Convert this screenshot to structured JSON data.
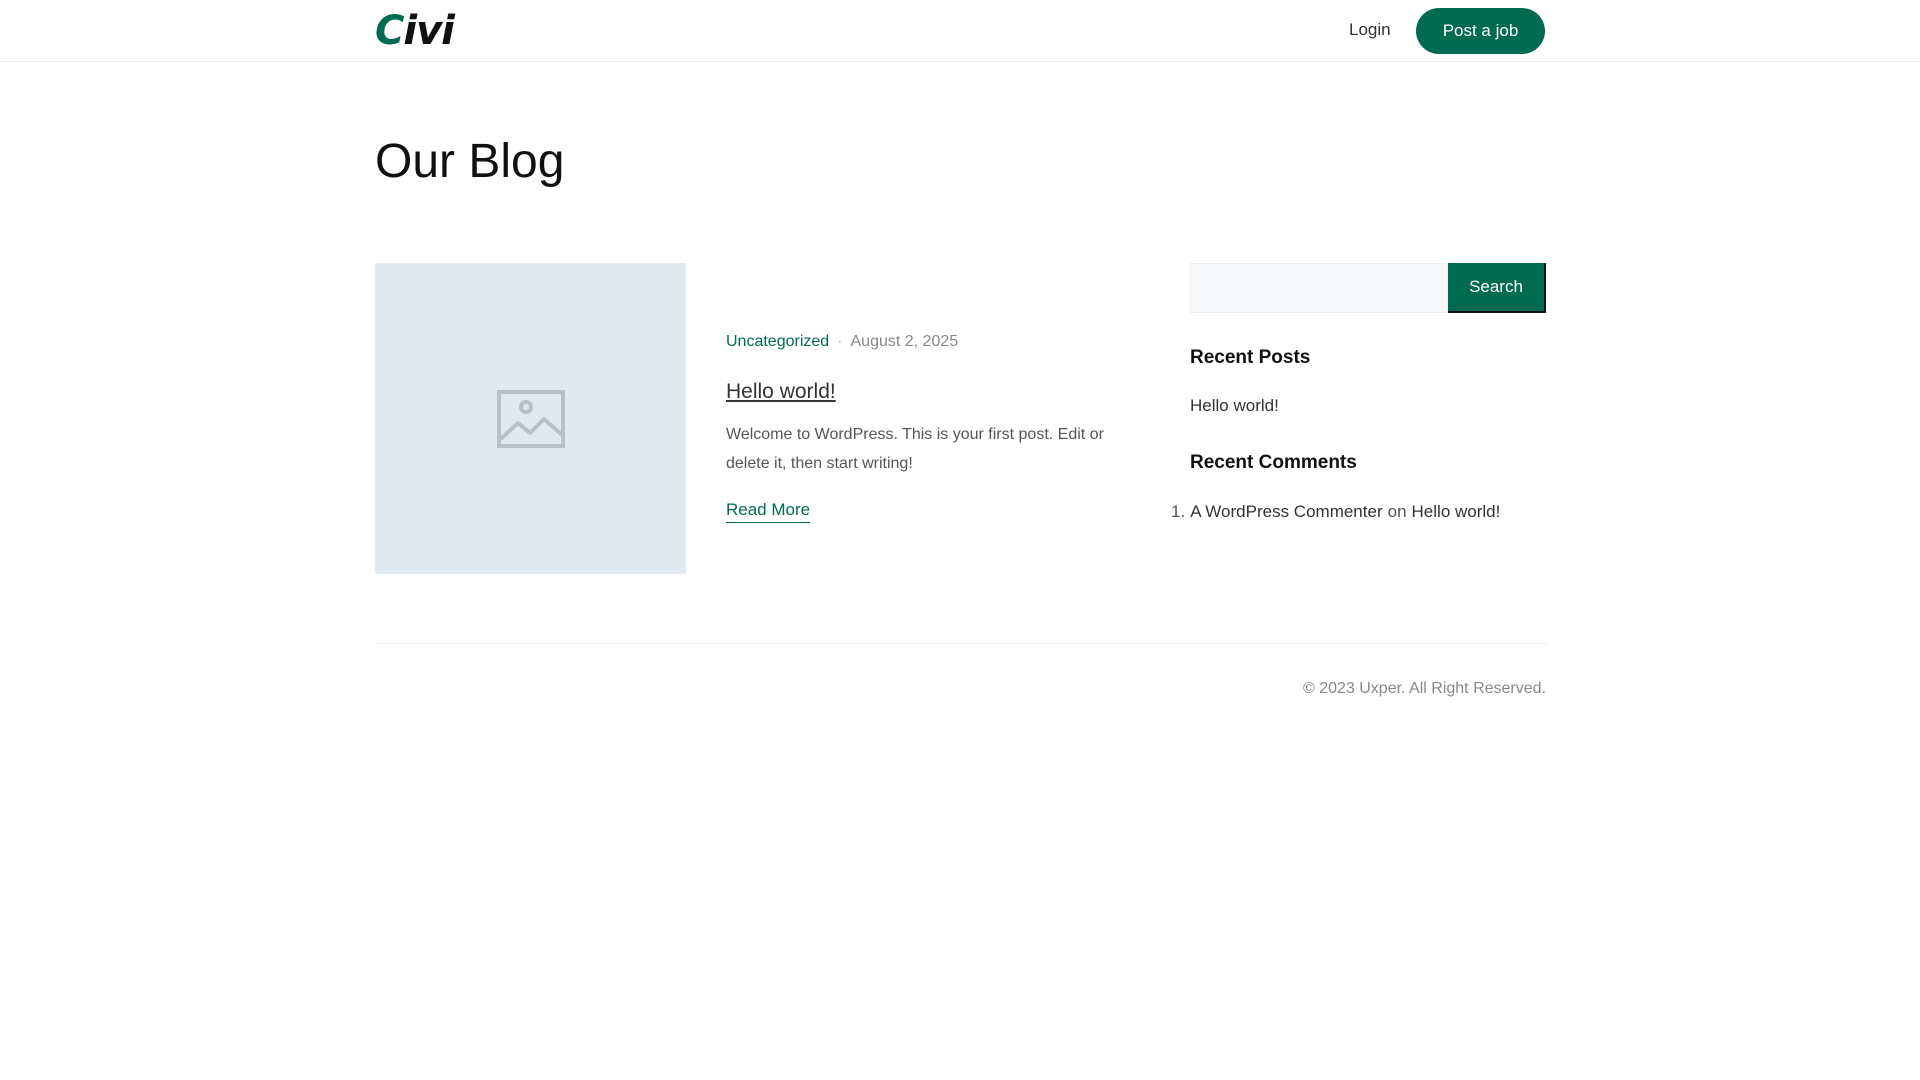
{
  "header": {
    "logo_initial": "C",
    "logo_rest": "ivi",
    "login_label": "Login",
    "post_job_label": "Post a job"
  },
  "page": {
    "title": "Our Blog"
  },
  "post": {
    "thumbnail_icon": "image-placeholder-icon",
    "category": "Uncategorized",
    "separator": "·",
    "date": "August 2, 2025",
    "title": "Hello world!",
    "excerpt": "Welcome to WordPress. This is your first post. Edit or delete it, then start writing!",
    "read_more_label": "Read More"
  },
  "sidebar": {
    "search": {
      "value": "",
      "placeholder": "",
      "button_label": "Search"
    },
    "recent_posts": {
      "title": "Recent Posts",
      "items": [
        "Hello world!"
      ]
    },
    "recent_comments": {
      "title": "Recent Comments",
      "items": [
        {
          "number": "1.",
          "author": "A WordPress Commenter",
          "connector": "on",
          "post": "Hello world!"
        }
      ]
    }
  },
  "footer": {
    "copyright": "© 2023 Uxper. All Right Reserved."
  },
  "colors": {
    "brand": "#006b4f",
    "thumbnail_bg": "#e1e8f0",
    "border": "#e9ecef"
  }
}
